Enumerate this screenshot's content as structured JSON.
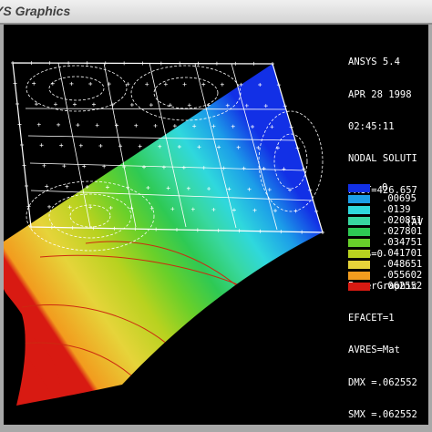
{
  "window": {
    "title": "YS Graphics"
  },
  "info_lines": [
    "ANSYS 5.4",
    "APR 28 1998",
    "02:45:11",
    "NODAL SOLUTI",
    "FACT=426.657",
    "UZ        (AV",
    "RSYS=0",
    "PowerGraphic",
    "EFACET=1",
    "AVRES=Mat",
    "DMX =.062552",
    "SMX =.062552"
  ],
  "legend": [
    {
      "value": "0",
      "color": "#1230e6"
    },
    {
      "value": ".00695",
      "color": "#1c9ee8"
    },
    {
      "value": ".0139",
      "color": "#2fd8dd"
    },
    {
      "value": ".020851",
      "color": "#38d8a0"
    },
    {
      "value": ".027801",
      "color": "#2ec954"
    },
    {
      "value": ".034751",
      "color": "#68d02a"
    },
    {
      "value": ".041701",
      "color": "#b8d21f"
    },
    {
      "value": ".048651",
      "color": "#e6d43a"
    },
    {
      "value": ".055602",
      "color": "#f29c1e"
    },
    {
      "value": ".062552",
      "color": "#d81a12"
    }
  ]
}
